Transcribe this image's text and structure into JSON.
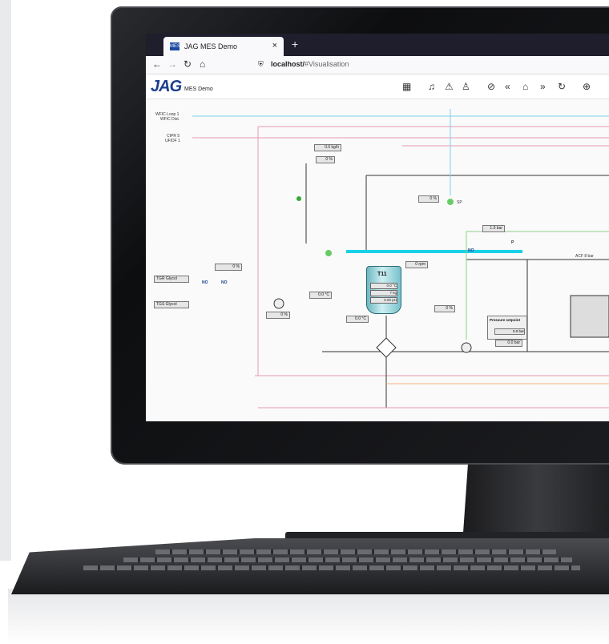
{
  "browser": {
    "tab_title": "JAG MES Demo",
    "tab_logo": "MES",
    "close_glyph": "×",
    "new_tab_glyph": "+",
    "url_host": "localhost/",
    "url_path": "#Visualisation"
  },
  "app": {
    "logo": "JAG",
    "subtitle": "MES Demo"
  },
  "toolbar": {
    "icons": [
      "calendar-icon",
      "bell-icon",
      "warning-icon",
      "alarm-user-icon",
      "tag-icon",
      "first-page-icon",
      "home-icon",
      "last-page-icon",
      "refresh-icon",
      "zoom-in-icon"
    ]
  },
  "process": {
    "sources": [
      {
        "line1": "WFIC Loop 1",
        "line2": "WFIC Dist."
      },
      {
        "line1": "CIPR 5",
        "line2": "UF/DF 1"
      }
    ],
    "glycol": {
      "tgr": "TGR Glycol",
      "tgs": "TGS Glycol"
    },
    "tank": {
      "name": "T11",
      "temp": "0.0 °C",
      "weight": "7 kg",
      "ph": "0.00 pH"
    },
    "agitator": "0 rpm",
    "flow": "0.0 kg/h",
    "valve_top": "0 %",
    "valve_mid": "0 %",
    "valve_left": "0 %",
    "pump_left": "0 %",
    "valve_right": "0 %",
    "temp_in": "0.0 °C",
    "temp_out": "0.0 °C",
    "pressure_top": "1.0 bar",
    "acf": "ACF 8 bar",
    "pressure_panel": {
      "title": "Pressure setpoint",
      "value": "0.0 bar"
    },
    "pressure_actual": "0.0 bar",
    "no": "NO",
    "p": "P",
    "sp": "SP"
  },
  "colors": {
    "pink": "#e79ab0",
    "cyan": "#7fd3e6",
    "orange": "#f2b37f",
    "green": "#8ed08b",
    "bus": "#19d1e6",
    "navy": "#1b3f8f"
  }
}
